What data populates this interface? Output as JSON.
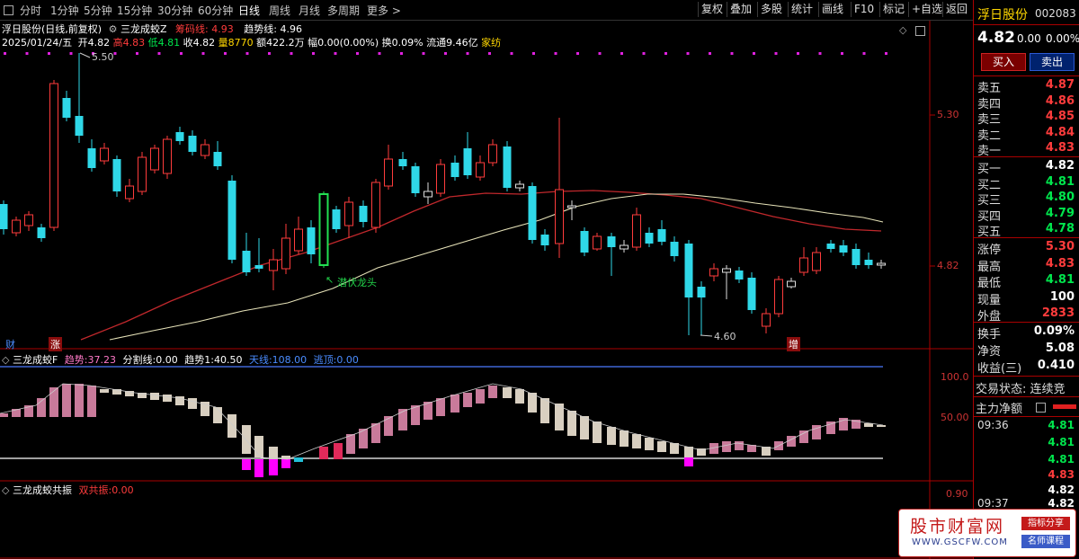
{
  "toolbar": {
    "periods": [
      "分时",
      "1分钟",
      "5分钟",
      "15分钟",
      "30分钟",
      "60分钟",
      "日线",
      "周线",
      "月线",
      "多周期",
      "更多 >"
    ],
    "buttons": [
      "复权",
      "叠加",
      "多股",
      "统计",
      "画线",
      "F10",
      "标记",
      "+自选",
      "返回"
    ]
  },
  "chart_header": {
    "line1_stock": "浮日股份(日线,前复权)",
    "line1_indicator": "三龙成蛟Z",
    "line1_chip_label": "筹码线:",
    "line1_chip_value": "4.93",
    "line1_trend_label": "趋势线:",
    "line1_trend_value": "4.96",
    "date": "2025/01/24/五",
    "open_label": "开",
    "open": "4.82",
    "high_label": "高",
    "high": "4.83",
    "low_label": "低",
    "low": "4.81",
    "close_label": "收",
    "close": "4.82",
    "vol_label": "量",
    "vol": "8770",
    "amount_label": "额",
    "amount": "422.2万",
    "amp_label": "幅",
    "amp": "0.00(0.00%)",
    "turnover_label": "换",
    "turnover": "0.09%",
    "float_label": "流通",
    "float": "9.46亿",
    "industry": "家纺"
  },
  "price_axis": {
    "labels": [
      "5.30",
      "4.82"
    ]
  },
  "annotations": {
    "high_mark": "5.50",
    "low_mark": "4.60",
    "signal_text": "潜伏龙头",
    "badge_cai": "财",
    "badge_zhang": "涨",
    "badge_zeng": "增"
  },
  "indicator1": {
    "name": "三龙成蛟F",
    "trend_label": "趋势:",
    "trend": "37.23",
    "split_label": "分割线:",
    "split": "0.00",
    "trend1_label": "趋势1:",
    "trend1": "40.50",
    "sky_label": "天线:",
    "sky": "108.00",
    "escape_label": "逃顶:",
    "escape": "0.00",
    "axis": [
      "100.0",
      "50.00"
    ]
  },
  "indicator2": {
    "name": "三龙成蛟共振",
    "resonance_label": "双共振:",
    "resonance": "0.00",
    "axis": [
      "0.90"
    ]
  },
  "quote_panel": {
    "name": "浮日股份",
    "code": "002083",
    "price": "4.82",
    "change": "0.00",
    "change_pct": "0.00%",
    "buy_btn": "买入",
    "sell_btn": "卖出",
    "asks": [
      {
        "label": "卖五",
        "price": "4.87"
      },
      {
        "label": "卖四",
        "price": "4.86"
      },
      {
        "label": "卖三",
        "price": "4.85"
      },
      {
        "label": "卖二",
        "price": "4.84"
      },
      {
        "label": "卖一",
        "price": "4.83"
      }
    ],
    "bids": [
      {
        "label": "买一",
        "price": "4.82"
      },
      {
        "label": "买二",
        "price": "4.81"
      },
      {
        "label": "买三",
        "price": "4.80"
      },
      {
        "label": "买四",
        "price": "4.79"
      },
      {
        "label": "买五",
        "price": "4.78"
      }
    ],
    "stats": [
      {
        "label": "涨停",
        "value": "5.30"
      },
      {
        "label": "最高",
        "value": "4.83"
      },
      {
        "label": "最低",
        "value": "4.81"
      },
      {
        "label": "现量",
        "value": "100"
      },
      {
        "label": "外盘",
        "value": "2833"
      }
    ],
    "stats2": [
      {
        "label": "换手",
        "value": "0.09%"
      },
      {
        "label": "净资",
        "value": "5.08"
      },
      {
        "label": "收益(三)",
        "value": "0.410"
      }
    ],
    "trade_status": "交易状态: 连续竞",
    "main_flow": "主力净额",
    "ticks": [
      {
        "time": "09:36",
        "price": "4.81"
      },
      {
        "time": "",
        "price": "4.81"
      },
      {
        "time": "",
        "price": "4.81"
      },
      {
        "time": "",
        "price": "4.83"
      },
      {
        "time": "",
        "price": "4.82"
      },
      {
        "time": "09:37",
        "price": "4.82"
      }
    ]
  },
  "watermark": {
    "title": "股市财富网",
    "url": "WWW.GSCFW.COM",
    "tag1": "指标分享",
    "tag2": "名师课程"
  },
  "colors": {
    "up": "#ff3c3c",
    "down": "#2fd8e8",
    "ma_red": "#c0282c",
    "ma_cream": "#e6e2b8",
    "hist_pink": "#c87a9a",
    "hist_beige": "#d8cfc0",
    "hist_magenta": "#ff00ff"
  }
}
